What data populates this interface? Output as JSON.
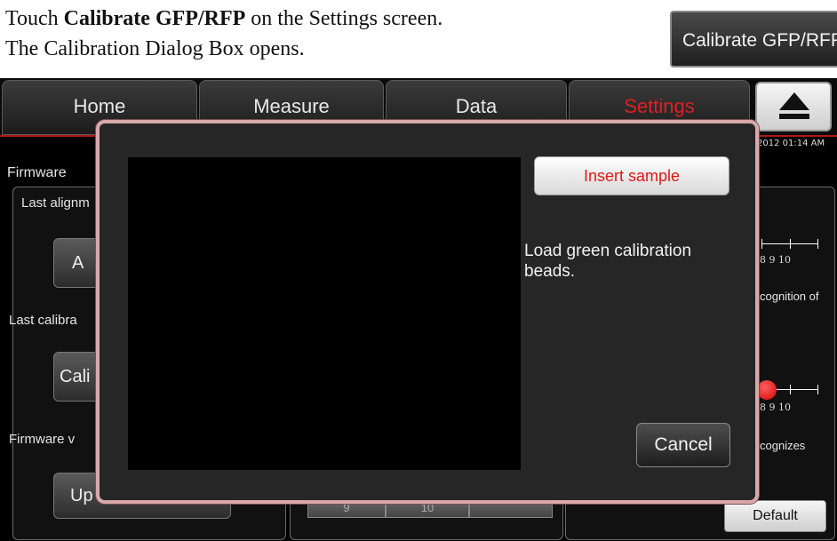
{
  "doc": {
    "line1_prefix": "Touch ",
    "line1_bold": "Calibrate GFP/RFP",
    "line1_suffix": " on the Settings screen.",
    "line2": "The Calibration Dialog Box opens.",
    "callout_button": "Calibrate GFP/RFP"
  },
  "tabs": [
    {
      "label": "Home"
    },
    {
      "label": "Measure"
    },
    {
      "label": "Data"
    },
    {
      "label": "Settings"
    }
  ],
  "colors": {
    "active_tab": "#e02020",
    "dialog_border": "#d7a9aa",
    "insert_text": "#e01818"
  },
  "eject_icon": "eject-icon",
  "datetime": "2012 01:14 AM",
  "background": {
    "firmware": "Firmware",
    "last_alignment": "Last alignm",
    "align_button": "A",
    "last_calibration": "Last calibra",
    "calibrate_button": "Cali",
    "firmware_version": "Firmware v",
    "update_button": "Up",
    "segments": [
      "9",
      "10",
      ""
    ],
    "slider1_nums": "8   9   10",
    "slider1_caption": "cognition of",
    "slider2_nums": "8   9   10",
    "slider2_caption": "cognizes",
    "default_button": "Default"
  },
  "dialog": {
    "insert_button": "Insert sample",
    "status_text": "Load green calibration beads.",
    "cancel_button": "Cancel"
  }
}
